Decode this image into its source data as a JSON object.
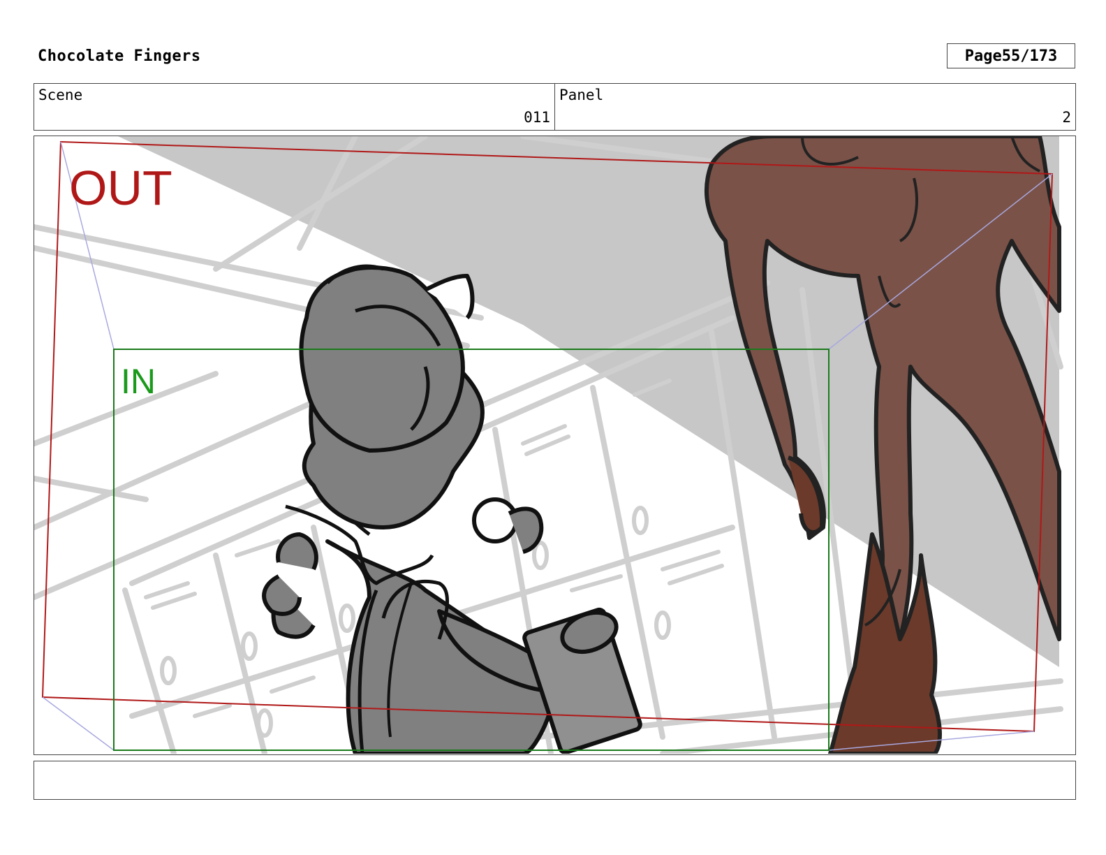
{
  "header": {
    "title": "Chocolate Fingers",
    "page_label": "Page",
    "page_value": "55/173"
  },
  "info": {
    "scene_label": "Scene",
    "scene_value": "011",
    "panel_label": "Panel",
    "panel_value": "2"
  },
  "panel": {
    "out_label": "OUT",
    "in_label": "IN",
    "out_color": "#b01818",
    "in_color": "#1a9a1a",
    "monster_color": "#7a5248",
    "monster_dark": "#6b3a2a",
    "character_fill": "#808080",
    "shadow_fill": "#c4c4c4",
    "sketch_lines": "#cfcfcf"
  },
  "notes": {
    "text": ""
  }
}
